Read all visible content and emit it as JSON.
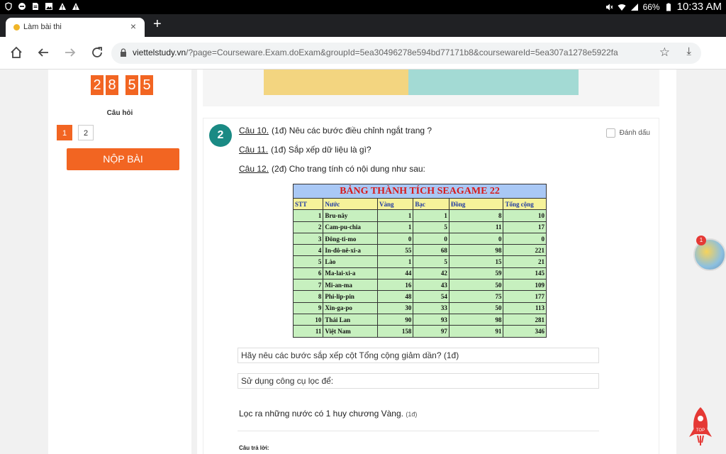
{
  "status_bar": {
    "left_icons": [
      "shield-icon",
      "minus-circle-icon",
      "file-icon",
      "image-icon",
      "warning-icon",
      "warning-icon"
    ],
    "battery": "66%",
    "time": "10:33 AM"
  },
  "browser": {
    "tab_title": "Làm bài thi",
    "url_domain": "viettelstudy.vn",
    "url_rest": "/?page=Courseware.Exam.doExam&groupId=5ea30496278e594bd77171b8&coursewareId=5ea307a1278e5922fa"
  },
  "sidebar": {
    "timer_digits": [
      "2",
      "8",
      "5",
      "5"
    ],
    "questions_label": "Câu hỏi",
    "question_numbers": [
      "1",
      "2"
    ],
    "submit_label": "NỘP BÀI"
  },
  "question": {
    "number": "2",
    "mark_label": "Đánh dấu",
    "items": [
      {
        "prefix": "Câu 10.",
        "text": "(1đ) Nêu các bước điều chỉnh ngắt trang ?"
      },
      {
        "prefix": "Câu 11.",
        "text": "(1đ) Sắp xếp dữ liệu là gì?"
      },
      {
        "prefix": "Câu 12.",
        "text": "(2đ) Cho trang tính có nội dung như sau:"
      }
    ],
    "table": {
      "title": "BẢNG THÀNH TÍCH SEAGAME 22",
      "headers": [
        "STT",
        "Nước",
        "Vàng",
        "Bạc",
        "Đồng",
        "Tổng cộng"
      ],
      "rows": [
        [
          "1",
          "Bru-nây",
          "1",
          "1",
          "8",
          "10"
        ],
        [
          "2",
          "Cam-pu-chia",
          "1",
          "5",
          "11",
          "17"
        ],
        [
          "3",
          "Đông-ti-mo",
          "0",
          "0",
          "0",
          "0"
        ],
        [
          "4",
          "In-đô-nê-xi-a",
          "55",
          "68",
          "98",
          "221"
        ],
        [
          "5",
          "Lào",
          "1",
          "5",
          "15",
          "21"
        ],
        [
          "6",
          "Ma-lai-xi-a",
          "44",
          "42",
          "59",
          "145"
        ],
        [
          "7",
          "Mi-an-ma",
          "16",
          "43",
          "50",
          "109"
        ],
        [
          "8",
          "Phi-lip-pin",
          "48",
          "54",
          "75",
          "177"
        ],
        [
          "9",
          "Xin-ga-po",
          "30",
          "33",
          "50",
          "113"
        ],
        [
          "10",
          "Thái Lan",
          "90",
          "93",
          "98",
          "281"
        ],
        [
          "11",
          "Việt Nam",
          "158",
          "97",
          "91",
          "346"
        ]
      ]
    },
    "sub1": "Hãy nêu các bước sắp xếp cột Tổng cộng giảm dần? (1đ)",
    "sub2": "Sử dụng công cụ lọc để:",
    "sub3": "Lọc ra những nước có 1 huy chương Vàng.",
    "sub3_points": "(1đ)",
    "reply_label": "Câu trả lời:"
  },
  "floating": {
    "notification_count": "1",
    "top_label": "TOP"
  },
  "colors": {
    "accent": "#f26522",
    "teal": "#1a8a84"
  }
}
